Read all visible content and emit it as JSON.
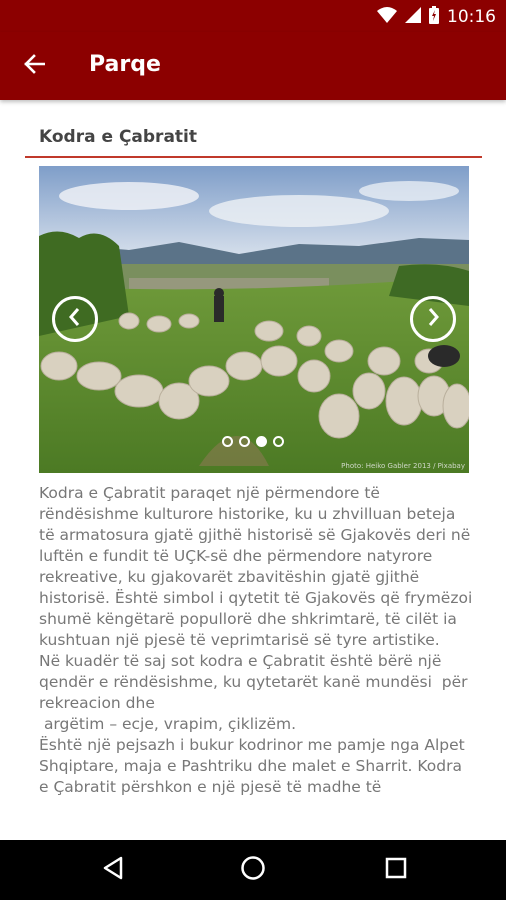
{
  "status_bar": {
    "time": "10:16"
  },
  "app_bar": {
    "title": "Parqe"
  },
  "section": {
    "title": "Kodra e Çabratit"
  },
  "slider": {
    "slide_count": 4,
    "active_index": 2,
    "credit": "Photo: Heiko Gabler 2013 / Pixabay"
  },
  "body_text": "Kodra e Çabratit paraqet një përmendore të rëndësishme kulturore historike, ku u zhvilluan beteja të armatosura gjatë gjithë historisë së Gjakovës deri në luftën e fundit të UÇK-së dhe përmendore natyrore rekreative, ku gjakovarët zbavitëshin gjatë gjithë historisë. Është simbol i qytetit të Gjakovës që frymëzoi shumë këngëtarë popullorë dhe shkrimtarë, të cilët ia kushtuan një pjesë të veprimtarisë së tyre artistike.\nNë kuadër të saj sot kodra e Çabratit është bërë një qendër e rëndësishme, ku qytetarët kanë mundësi  për rekreacion dhe\n argëtim – ecje, vrapim, çiklizëm.\nËshtë një pejsazh i bukur kodrinor me pamje nga Alpet Shqiptare, maja e Pashtriku dhe malet e Sharrit. Kodra e Çabratit përshkon e një pjesë të madhe të",
  "colors": {
    "primary": "#8c0000",
    "divider": "#c0392b",
    "text": "#777777"
  },
  "icons": {
    "status": [
      "wifi-icon",
      "cell-signal-icon",
      "battery-icon"
    ],
    "app_bar": [
      "back-arrow-icon"
    ],
    "slider": [
      "chevron-left-icon",
      "chevron-right-icon"
    ],
    "nav": [
      "nav-back-icon",
      "nav-home-icon",
      "nav-recents-icon"
    ]
  }
}
